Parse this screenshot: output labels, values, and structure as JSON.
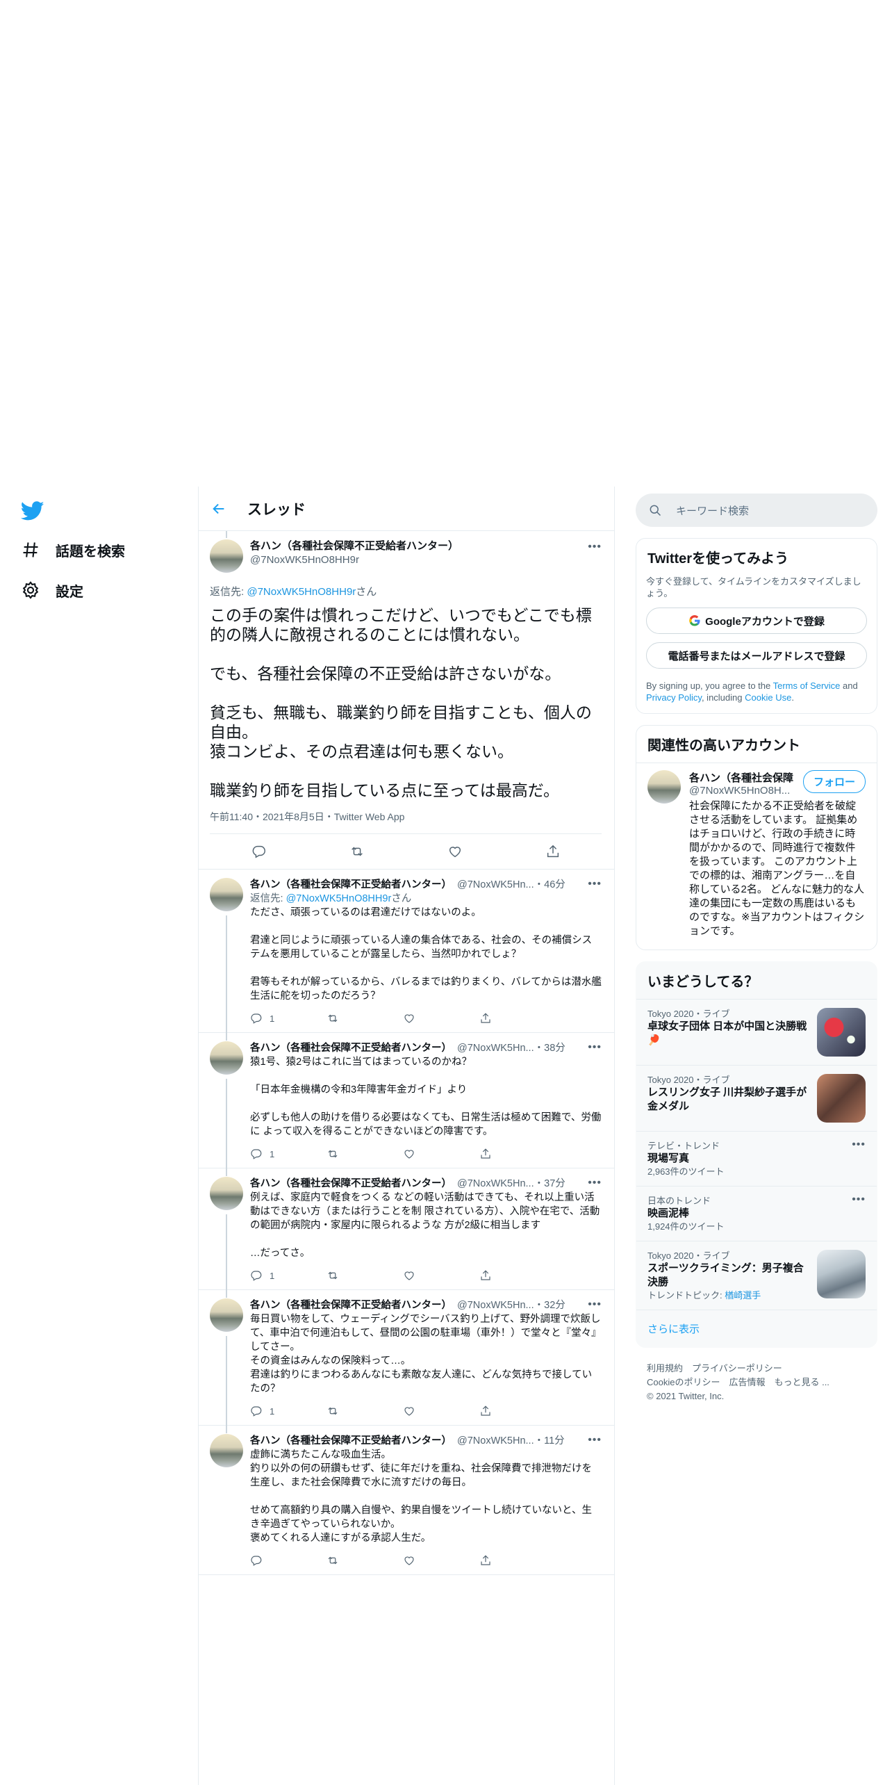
{
  "nav": {
    "explore_label": "話題を検索",
    "settings_label": "設定"
  },
  "header": {
    "title": "スレッド"
  },
  "main_tweet": {
    "name": "各ハン（各種社会保障不正受給者ハンター）",
    "handle": "@7NoxWK5HnO8HH9r",
    "reply_prefix": "返信先: ",
    "reply_handle": "@7NoxWK5HnO8HH9r",
    "reply_suffix": "さん",
    "text": "この手の案件は慣れっこだけど、いつでもどこでも標的の隣人に敵視されるのことには慣れない。\n\nでも、各種社会保障の不正受給は許さないがな。\n\n貧乏も、無職も、職業釣り師を目指すことも、個人の自由。\n猿コンビよ、その点君達は何も悪くない。\n\n職業釣り師を目指している点に至っては最高だ。",
    "meta": "午前11:40・2021年8月5日・Twitter Web App"
  },
  "replies": [
    {
      "name": "各ハン（各種社会保障不正受給者ハンター）",
      "handle": "@7NoxWK5Hn...",
      "time": "・46分",
      "reply_prefix": "返信先: ",
      "reply_handle": "@7NoxWK5HnO8HH9r",
      "reply_suffix": "さん",
      "text": "たださ、頑張っているのは君達だけではないのよ。\n\n君達と同じように頑張っている人達の集合体である、社会の、その補償システムを悪用していることが露呈したら、当然叩かれでしょ？\n\n君等もそれが解っているから、バレるまでは釣りまくり、バレてからは潜水艦生活に舵を切ったのだろう？",
      "replies": "1"
    },
    {
      "name": "各ハン（各種社会保障不正受給者ハンター）",
      "handle": "@7NoxWK5Hn...",
      "time": "・38分",
      "text": "猿1号、猿2号はこれに当てはまっているのかね？\n\n「日本年金機構の令和3年障害年金ガイド」より\n\n必ずしも他人の助けを借りる必要はなくても、日常生活は極めて困難で、労働に よって収入を得ることができないほどの障害です。",
      "replies": "1"
    },
    {
      "name": "各ハン（各種社会保障不正受給者ハンター）",
      "handle": "@7NoxWK5Hn...",
      "time": "・37分",
      "text": "例えば、家庭内で軽食をつくる などの軽い活動はできても、それ以上重い活動はできない方（または行うことを制 限されている方）、入院や在宅で、活動の範囲が病院内・家屋内に限られるような 方が2級に相当します\n\n…だってさ。",
      "replies": "1"
    },
    {
      "name": "各ハン（各種社会保障不正受給者ハンター）",
      "handle": "@7NoxWK5Hn...",
      "time": "・32分",
      "text": "毎日買い物をして、ウェーディングでシーバス釣り上げて、野外調理で炊飯して、車中泊で何連泊もして、昼間の公園の駐車場（車外！）で堂々と『堂々』してさー。\nその資金はみんなの保険料って…。\n君達は釣りにまつわるあんなにも素敵な友人達に、どんな気持ちで接していたの？",
      "replies": "1"
    },
    {
      "name": "各ハン（各種社会保障不正受給者ハンター）",
      "handle": "@7NoxWK5Hn...",
      "time": "・11分",
      "text": "虚飾に満ちたこんな吸血生活。\n釣り以外の何の研鑽もせず、徒に年だけを重ね、社会保障費で排泄物だけを生産し、また社会保障費で水に流すだけの毎日。\n\nせめて高額釣り具の購入自慢や、釣果自慢をツイートし続けていないと、生き辛過ぎてやっていられないか。\n褒めてくれる人達にすがる承認人生だ。",
      "replies": ""
    }
  ],
  "sidebar": {
    "search_placeholder": "キーワード検索",
    "join": {
      "title": "Twitterを使ってみよう",
      "desc": "今すぐ登録して、タイムラインをカスタマイズしましょう。",
      "google_btn": "Googleアカウントで登録",
      "phone_btn": "電話番号またはメールアドレスで登録",
      "legal_1": "By signing up, you agree to the ",
      "legal_terms": "Terms of Service",
      "legal_2": " and ",
      "legal_privacy": "Privacy Policy",
      "legal_3": ", including ",
      "legal_cookie": "Cookie Use",
      "legal_4": "."
    },
    "related": {
      "title": "関連性の高いアカウント",
      "name": "各ハン（各種社会保障",
      "handle": "@7NoxWK5HnO8H...",
      "follow": "フォロー",
      "bio": "社会保障にたかる不正受給者を破綻させる活動をしています。 証拠集めはチョロいけど、行政の手続きに時間がかかるので、同時進行で複数件を扱っています。 このアカウント上での標的は、湘南アングラー…を自称している2名。 どんなに魅力的な人達の集団にも一定数の馬鹿はいるものですな。※当アカウントはフィクションです。"
    },
    "trends": {
      "title": "いまどうしてる？",
      "items": [
        {
          "ctx": "Tokyo 2020・ライブ",
          "title": "卓球女子団体 日本が中国と決勝戦 🏓",
          "count": "",
          "img": "pingpong"
        },
        {
          "ctx": "Tokyo 2020・ライブ",
          "title": "レスリング女子 川井梨紗子選手が金メダル",
          "count": "",
          "img": "wrestling"
        },
        {
          "ctx": "テレビ・トレンド",
          "title": "現場写真",
          "count": "2,963件のツイート",
          "img": ""
        },
        {
          "ctx": "日本のトレンド",
          "title": "映画泥棒",
          "count": "1,924件のツイート",
          "img": ""
        },
        {
          "ctx": "Tokyo 2020・ライブ",
          "title": "スポーツクライミング：男子複合決勝",
          "count": "トレンドトピック: ",
          "count_link": "楢崎選手",
          "img": "climbing"
        }
      ],
      "show_more": "さらに表示"
    },
    "footer": {
      "line1": "利用規約　プライバシーポリシー",
      "line2": "Cookieのポリシー　広告情報　もっと見る ...",
      "line3": "© 2021 Twitter, Inc."
    }
  },
  "colors": {
    "accent": "#1da1f2",
    "link": "#1b95e0",
    "border": "#e6ecf0"
  }
}
